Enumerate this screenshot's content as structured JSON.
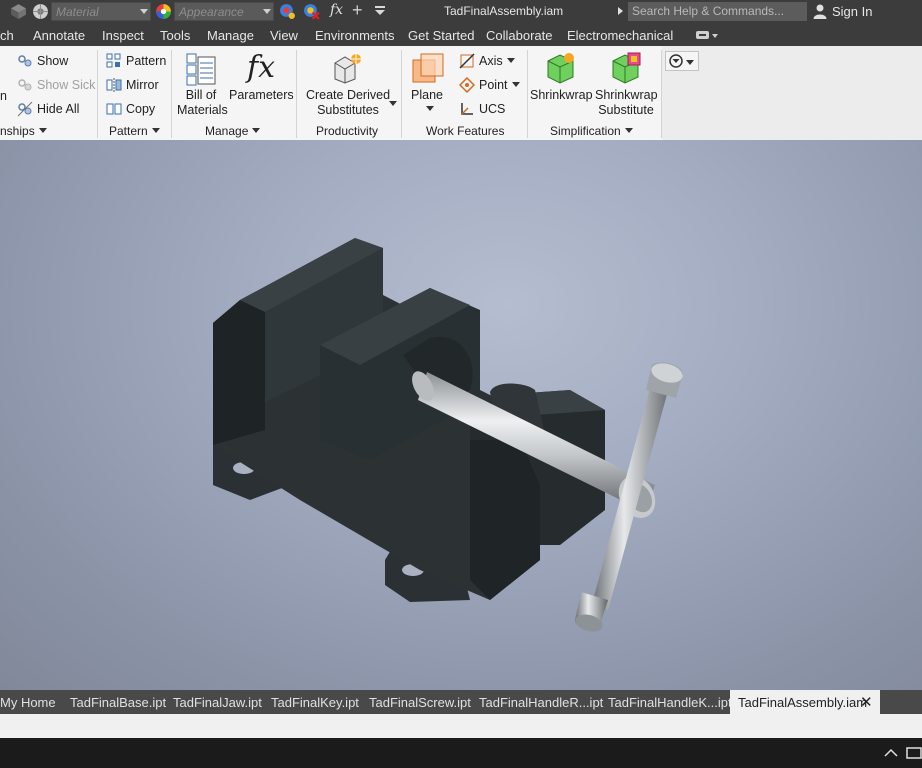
{
  "titlebar": {
    "material_placeholder": "Material",
    "appearance_placeholder": "Appearance",
    "fx_symbol": "fx",
    "plus_symbol": "+",
    "document_title": "TadFinalAssembly.iam",
    "search_placeholder": "Search Help & Commands...",
    "sign_in": "Sign In"
  },
  "menu": {
    "items": [
      "ch",
      "Annotate",
      "Inspect",
      "Tools",
      "Manage",
      "View",
      "Environments",
      "Get Started",
      "Collaborate",
      "Electromechanical"
    ]
  },
  "ribbon": {
    "relationships": {
      "show": "Show",
      "show_sick": "Show Sick",
      "hide_all": "Hide All",
      "partial_left": "n",
      "title": "nships"
    },
    "pattern": {
      "pattern": "Pattern",
      "mirror": "Mirror",
      "copy": "Copy",
      "title": "Pattern"
    },
    "manage": {
      "bom_line1": "Bill of",
      "bom_line2": "Materials",
      "parameters": "Parameters",
      "fx_glyph": "fx",
      "title": "Manage"
    },
    "productivity": {
      "line1": "Create Derived",
      "line2": "Substitutes",
      "title": "Productivity"
    },
    "work_features": {
      "plane": "Plane",
      "axis": "Axis",
      "point": "Point",
      "ucs": "UCS",
      "title": "Work Features"
    },
    "simplification": {
      "shrinkwrap": "Shrinkwrap",
      "sub_line1": "Shrinkwrap",
      "sub_line2": "Substitute",
      "title": "Simplification"
    }
  },
  "doctabs": {
    "tabs": [
      "My Home",
      "TadFinalBase.ipt",
      "TadFinalJaw.ipt",
      "TadFinalKey.ipt",
      "TadFinalScrew.ipt",
      "TadFinalHandleR...ipt",
      "TadFinalHandleK...ipt"
    ],
    "active": "TadFinalAssembly.iam",
    "close": "✕"
  },
  "colors": {
    "chrome": "#3c3c3c",
    "ribbon": "#f5f5f5",
    "vise_dark": "#2c3234",
    "steel": "#bfc3c6"
  }
}
